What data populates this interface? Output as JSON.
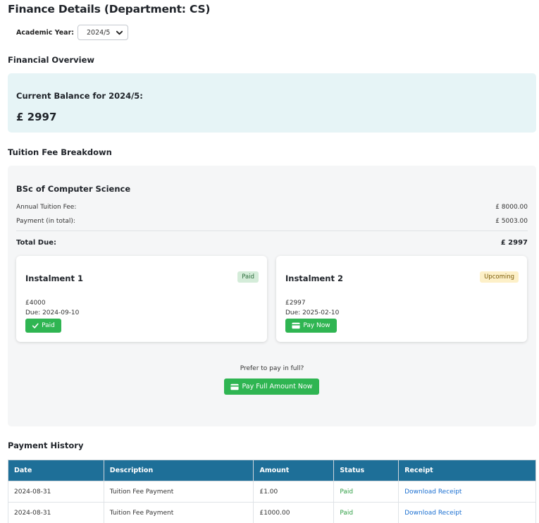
{
  "page": {
    "title": "Finance Details (Department: CS)",
    "academic_year_label": "Academic Year:",
    "academic_year_value": "2024/5"
  },
  "overview": {
    "section_title": "Financial Overview",
    "balance_label": "Current Balance for 2024/5:",
    "balance_value": "£ 2997"
  },
  "breakdown": {
    "section_title": "Tuition Fee Breakdown",
    "program": "BSc of Computer Science",
    "annual_fee_label": "Annual Tuition Fee:",
    "annual_fee_value": "£ 8000.00",
    "payment_label": "Payment (in total):",
    "payment_value": "£ 5003.00",
    "total_due_label": "Total Due:",
    "total_due_value": "£ 2997",
    "instalments": [
      {
        "title": "Instalment 1",
        "badge": "Paid",
        "amount": "£4000",
        "due": "Due: 2024-09-10",
        "button": "Paid"
      },
      {
        "title": "Instalment 2",
        "badge": "Upcoming",
        "amount": "£2997",
        "due": "Due: 2025-02-10",
        "button": "Pay Now"
      }
    ],
    "prefer_text": "Prefer to pay in full?",
    "pay_full_button": "Pay Full Amount Now"
  },
  "history": {
    "section_title": "Payment History",
    "columns": [
      "Date",
      "Description",
      "Amount",
      "Status",
      "Receipt"
    ],
    "rows": [
      {
        "date": "2024-08-31",
        "description": "Tuition Fee Payment",
        "amount": "£1.00",
        "status": "Paid",
        "receipt": "Download Receipt"
      },
      {
        "date": "2024-08-31",
        "description": "Tuition Fee Payment",
        "amount": "£1000.00",
        "status": "Paid",
        "receipt": "Download Receipt"
      }
    ]
  },
  "colors": {
    "accent_green": "#2fb552",
    "table_header": "#1e6f98",
    "overview_bg": "#e6f4f6",
    "link": "#1a6fd1"
  },
  "icons": [
    "chevron-down-icon",
    "check-icon",
    "credit-card-icon"
  ]
}
